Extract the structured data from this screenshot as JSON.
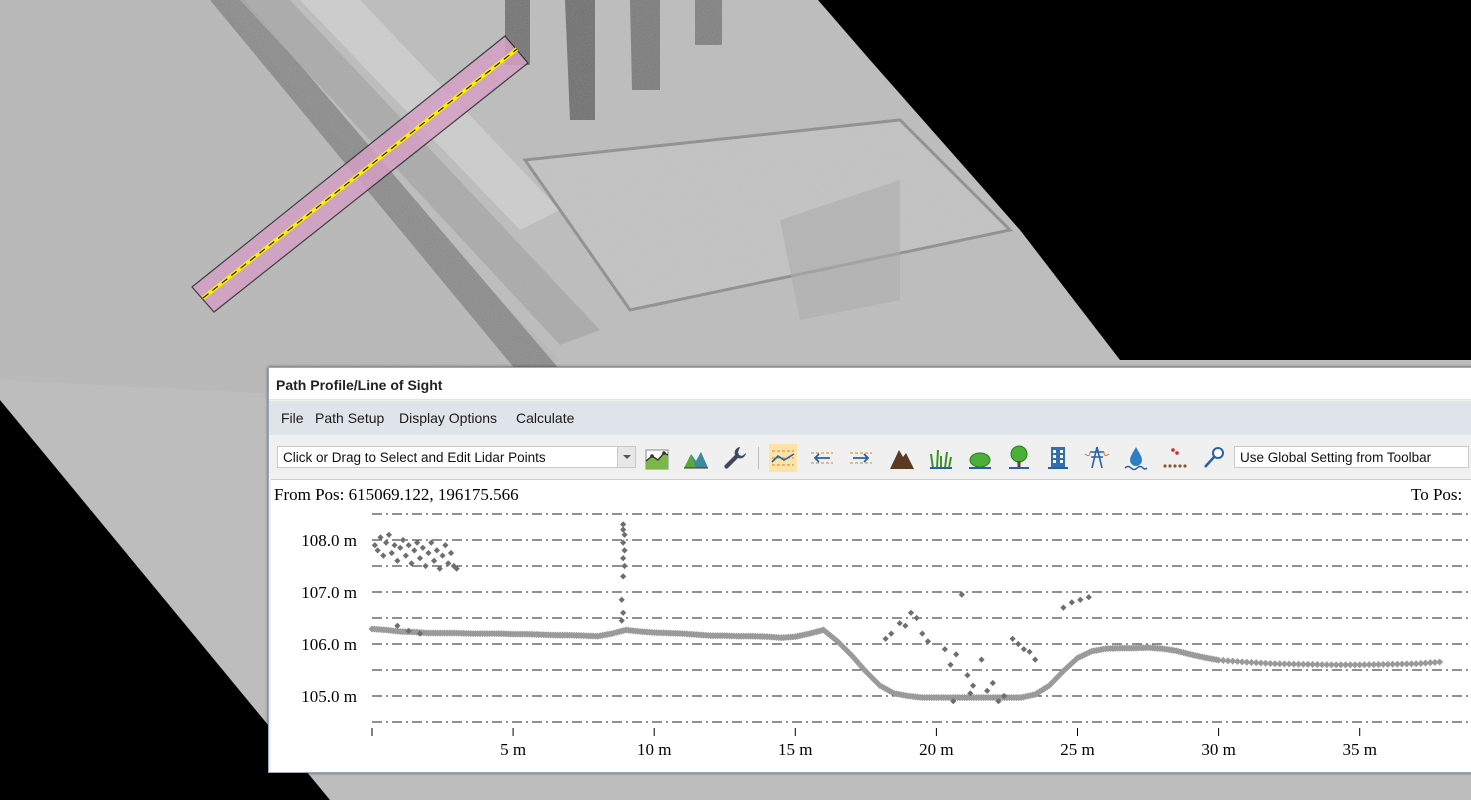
{
  "map": {
    "selected_path": "path-profile-line",
    "colors": {
      "path_fill": "#d4a0c4",
      "path_line": "#ffee00"
    }
  },
  "window": {
    "title": "Path Profile/Line of Sight",
    "menu": [
      "File",
      "Path Setup",
      "Display Options",
      "Calculate"
    ],
    "toolbar": {
      "mode_select": "Click or Drag to Select and Edit Lidar Points",
      "setting_select": "Use Global Setting from Toolbar",
      "icons": [
        "terrain-profile-icon",
        "3d-terrain-icon",
        "wrench-icon",
        "profile-display-icon",
        "reverse-path-icon",
        "forward-path-icon",
        "mountain-icon",
        "grass-icon",
        "shrub-icon",
        "tree-icon",
        "building-icon",
        "power-line-icon",
        "water-icon",
        "point-cloud-icon",
        "pin-tool-icon"
      ]
    },
    "profile": {
      "from_pos": "From Pos: 615069.122, 196175.566",
      "to_pos": "To Pos:"
    }
  },
  "chart_data": {
    "type": "scatter",
    "title": "",
    "xlabel": "",
    "ylabel": "",
    "x_ticks": [
      "5 m",
      "10 m",
      "15 m",
      "20 m",
      "25 m",
      "30 m",
      "35 m"
    ],
    "x_tick_values": [
      5,
      10,
      15,
      20,
      25,
      30,
      35
    ],
    "y_ticks": [
      "105.0 m",
      "106.0 m",
      "107.0 m",
      "108.0 m"
    ],
    "y_tick_values": [
      105.0,
      106.0,
      107.0,
      108.0
    ],
    "xlim": [
      0,
      38.2
    ],
    "ylim": [
      104.5,
      108.6
    ],
    "grid": true,
    "series": [
      {
        "color": "#9a9a9a",
        "points": [
          [
            0,
            106.29
          ],
          [
            0.5,
            106.27
          ],
          [
            1,
            106.24
          ],
          [
            1.5,
            106.23
          ],
          [
            2,
            106.21
          ],
          [
            2.5,
            106.21
          ],
          [
            3,
            106.21
          ],
          [
            3.5,
            106.2
          ],
          [
            4,
            106.2
          ],
          [
            4.5,
            106.2
          ],
          [
            5,
            106.19
          ],
          [
            5.5,
            106.19
          ],
          [
            6,
            106.18
          ],
          [
            6.5,
            106.17
          ],
          [
            7,
            106.17
          ],
          [
            7.5,
            106.16
          ],
          [
            8,
            106.15
          ],
          [
            8.5,
            106.2
          ],
          [
            9,
            106.27
          ],
          [
            9.5,
            106.24
          ],
          [
            10,
            106.22
          ],
          [
            10.5,
            106.21
          ],
          [
            11,
            106.2
          ],
          [
            11.5,
            106.18
          ],
          [
            12,
            106.16
          ],
          [
            12.5,
            106.16
          ],
          [
            13,
            106.15
          ],
          [
            13.5,
            106.15
          ],
          [
            14,
            106.14
          ],
          [
            14.5,
            106.12
          ],
          [
            15,
            106.14
          ],
          [
            15.5,
            106.2
          ],
          [
            16,
            106.27
          ],
          [
            16.5,
            106.05
          ],
          [
            17,
            105.78
          ],
          [
            17.5,
            105.47
          ],
          [
            18,
            105.2
          ],
          [
            18.5,
            105.05
          ],
          [
            19,
            105.0
          ],
          [
            19.5,
            104.97
          ],
          [
            20,
            104.97
          ],
          [
            20.5,
            104.97
          ],
          [
            21,
            104.97
          ],
          [
            21.5,
            104.97
          ],
          [
            22,
            104.97
          ],
          [
            22.5,
            104.97
          ],
          [
            23,
            104.97
          ],
          [
            23.5,
            105.03
          ],
          [
            24,
            105.2
          ],
          [
            24.5,
            105.48
          ],
          [
            25,
            105.73
          ],
          [
            25.5,
            105.86
          ],
          [
            26,
            105.91
          ],
          [
            26.5,
            105.92
          ],
          [
            27,
            105.92
          ],
          [
            27.5,
            105.93
          ],
          [
            28,
            105.91
          ],
          [
            28.5,
            105.87
          ],
          [
            29,
            105.8
          ],
          [
            29.5,
            105.74
          ],
          [
            30,
            105.69
          ],
          [
            31,
            105.65
          ],
          [
            32,
            105.62
          ],
          [
            33,
            105.61
          ],
          [
            34,
            105.6
          ],
          [
            35,
            105.6
          ],
          [
            36,
            105.61
          ],
          [
            37,
            105.62
          ],
          [
            38,
            105.66
          ]
        ]
      },
      {
        "color": "#6e6e6e",
        "points": [
          [
            0.1,
            107.9
          ],
          [
            0.2,
            107.8
          ],
          [
            0.3,
            108.05
          ],
          [
            0.4,
            107.7
          ],
          [
            0.5,
            107.95
          ],
          [
            0.6,
            108.1
          ],
          [
            0.7,
            107.75
          ],
          [
            0.8,
            107.9
          ],
          [
            0.9,
            107.6
          ],
          [
            1.0,
            107.85
          ],
          [
            1.1,
            108.0
          ],
          [
            1.2,
            107.7
          ],
          [
            1.3,
            107.9
          ],
          [
            1.4,
            107.55
          ],
          [
            1.5,
            107.8
          ],
          [
            1.6,
            107.95
          ],
          [
            1.7,
            107.65
          ],
          [
            1.8,
            107.85
          ],
          [
            1.9,
            107.5
          ],
          [
            2.0,
            107.75
          ],
          [
            2.1,
            107.95
          ],
          [
            2.2,
            107.6
          ],
          [
            2.3,
            107.8
          ],
          [
            2.4,
            107.45
          ],
          [
            2.5,
            107.7
          ],
          [
            2.6,
            107.9
          ],
          [
            2.7,
            107.55
          ],
          [
            2.8,
            107.75
          ],
          [
            2.9,
            107.5
          ],
          [
            3.0,
            107.45
          ],
          [
            0.9,
            106.35
          ],
          [
            1.3,
            106.25
          ],
          [
            1.7,
            106.2
          ],
          [
            8.9,
            108.3
          ],
          [
            8.9,
            108.2
          ],
          [
            8.95,
            108.1
          ],
          [
            8.9,
            107.95
          ],
          [
            8.95,
            107.8
          ],
          [
            8.9,
            107.65
          ],
          [
            8.95,
            107.5
          ],
          [
            8.9,
            107.3
          ],
          [
            8.85,
            106.85
          ],
          [
            8.9,
            106.6
          ],
          [
            8.85,
            106.45
          ],
          [
            18.2,
            106.1
          ],
          [
            18.4,
            106.2
          ],
          [
            18.7,
            106.4
          ],
          [
            18.9,
            106.35
          ],
          [
            19.1,
            106.6
          ],
          [
            19.3,
            106.5
          ],
          [
            19.5,
            106.2
          ],
          [
            19.7,
            106.05
          ],
          [
            20.3,
            105.9
          ],
          [
            20.5,
            105.6
          ],
          [
            20.7,
            105.8
          ],
          [
            20.9,
            106.95
          ],
          [
            21.1,
            105.4
          ],
          [
            21.3,
            105.2
          ],
          [
            21.6,
            105.7
          ],
          [
            22.0,
            105.25
          ],
          [
            22.4,
            105.0
          ],
          [
            22.7,
            106.1
          ],
          [
            22.9,
            106.0
          ],
          [
            23.1,
            105.9
          ],
          [
            23.3,
            105.85
          ],
          [
            23.5,
            105.7
          ],
          [
            24.5,
            106.7
          ],
          [
            24.8,
            106.8
          ],
          [
            25.1,
            106.85
          ],
          [
            25.4,
            106.9
          ],
          [
            20.6,
            104.9
          ],
          [
            21.2,
            105.05
          ],
          [
            21.8,
            105.1
          ],
          [
            22.2,
            104.9
          ]
        ]
      }
    ]
  }
}
